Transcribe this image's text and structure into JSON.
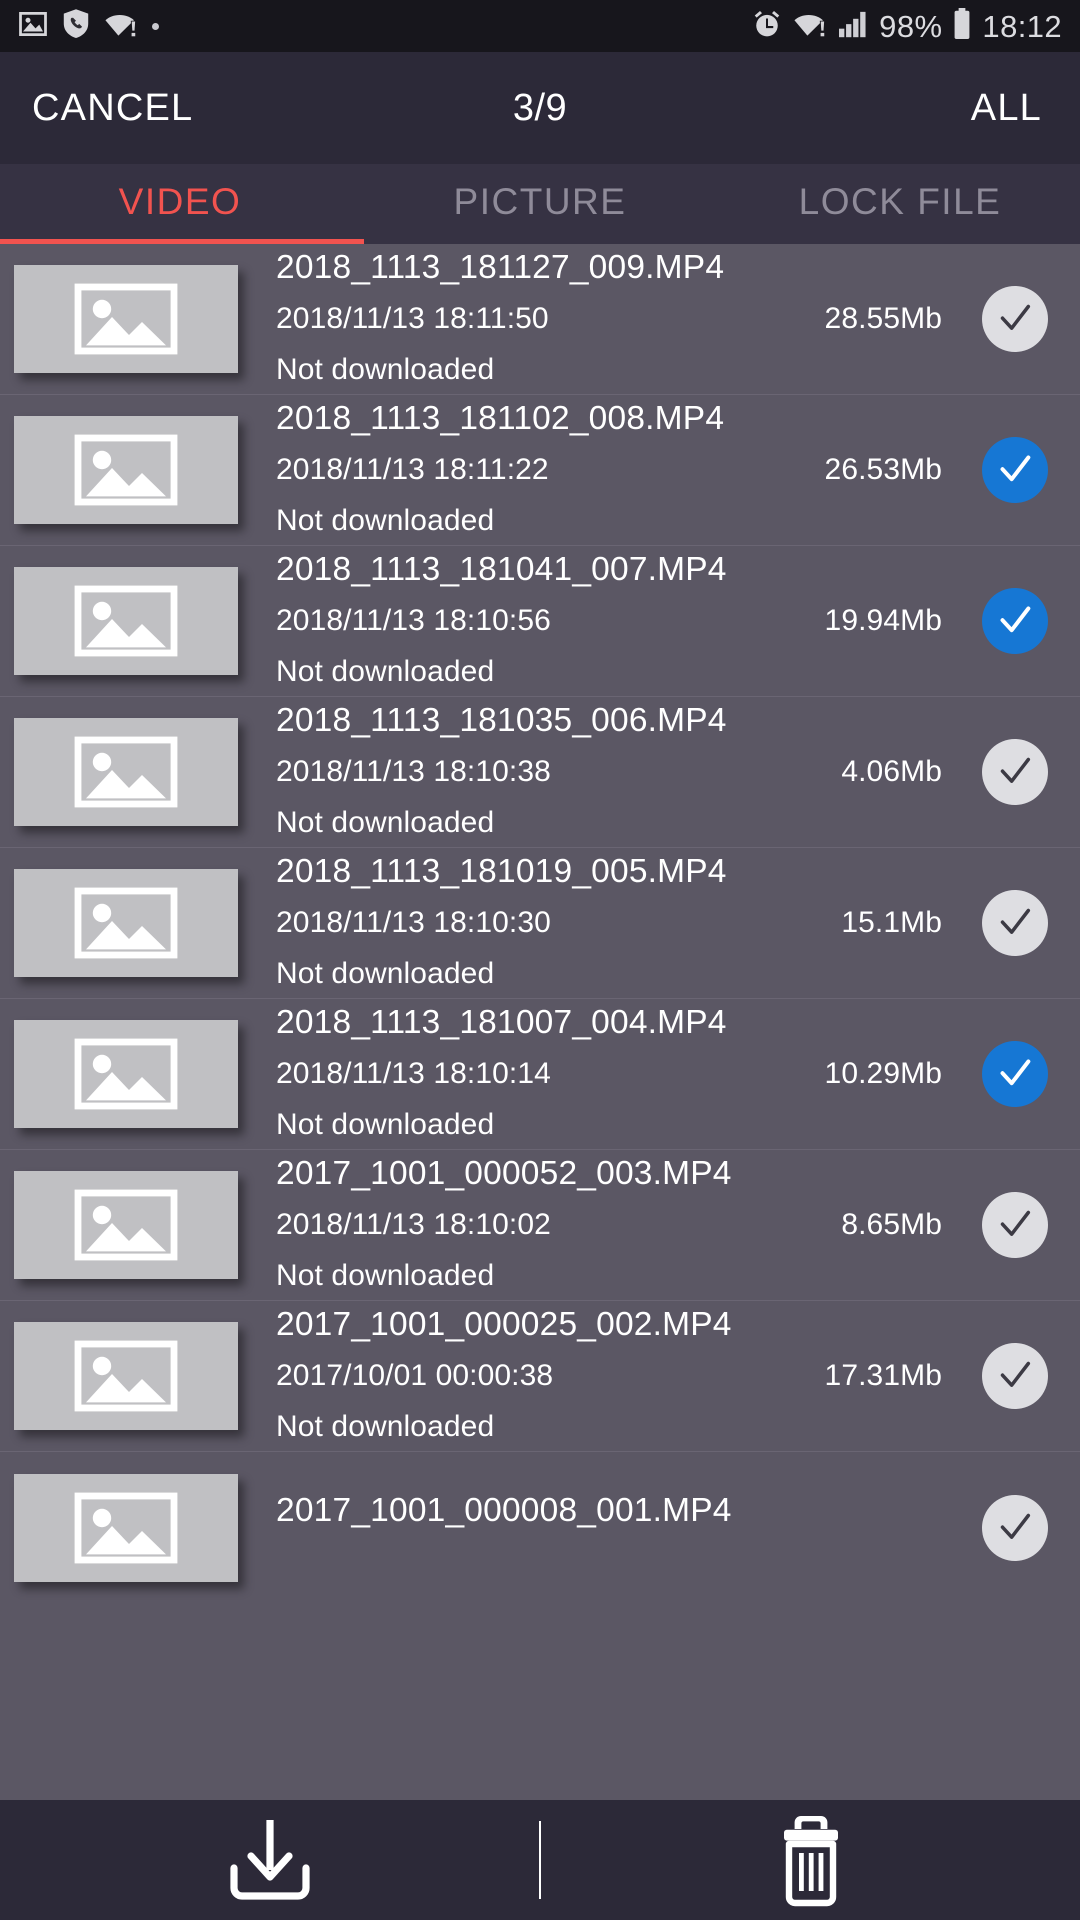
{
  "status_bar": {
    "left_icons": [
      "image-icon",
      "shield-phone-icon",
      "wifi-alert-icon",
      "dot-icon"
    ],
    "right_icons": [
      "alarm-icon",
      "wifi-alert-icon",
      "signal-icon",
      "battery-icon"
    ],
    "battery_percent": "98%",
    "clock": "18:12"
  },
  "action_bar": {
    "cancel_label": "CANCEL",
    "counter": "3/9",
    "all_label": "ALL"
  },
  "tabs": [
    {
      "label": "VIDEO",
      "active": true
    },
    {
      "label": "PICTURE",
      "active": false
    },
    {
      "label": "LOCK FILE",
      "active": false
    }
  ],
  "colors": {
    "accent": "#f2534f",
    "checked": "#1677d4",
    "unchecked": "#dedee2",
    "status_bar_bg": "#17161c",
    "action_bar_bg": "#2c2938",
    "tab_bar_bg": "#363243",
    "list_bg": "#5b5764",
    "thumb_bg": "#c0c0c3"
  },
  "files": [
    {
      "name": "2018_1113_181127_009.MP4",
      "date": "2018/11/13 18:11:50",
      "size": "28.55Mb",
      "status": "Not downloaded",
      "selected": false
    },
    {
      "name": "2018_1113_181102_008.MP4",
      "date": "2018/11/13 18:11:22",
      "size": "26.53Mb",
      "status": "Not downloaded",
      "selected": true
    },
    {
      "name": "2018_1113_181041_007.MP4",
      "date": "2018/11/13 18:10:56",
      "size": "19.94Mb",
      "status": "Not downloaded",
      "selected": true
    },
    {
      "name": "2018_1113_181035_006.MP4",
      "date": "2018/11/13 18:10:38",
      "size": "4.06Mb",
      "status": "Not downloaded",
      "selected": false
    },
    {
      "name": "2018_1113_181019_005.MP4",
      "date": "2018/11/13 18:10:30",
      "size": "15.1Mb",
      "status": "Not downloaded",
      "selected": false
    },
    {
      "name": "2018_1113_181007_004.MP4",
      "date": "2018/11/13 18:10:14",
      "size": "10.29Mb",
      "status": "Not downloaded",
      "selected": true
    },
    {
      "name": "2017_1001_000052_003.MP4",
      "date": "2018/11/13 18:10:02",
      "size": "8.65Mb",
      "status": "Not downloaded",
      "selected": false
    },
    {
      "name": "2017_1001_000025_002.MP4",
      "date": "2017/10/01 00:00:38",
      "size": "17.31Mb",
      "status": "Not downloaded",
      "selected": false
    },
    {
      "name": "2017_1001_000008_001.MP4",
      "date": "",
      "size": "",
      "status": "",
      "selected": false
    }
  ],
  "bottom_bar": {
    "download_icon": "download-icon",
    "delete_icon": "trash-icon"
  }
}
